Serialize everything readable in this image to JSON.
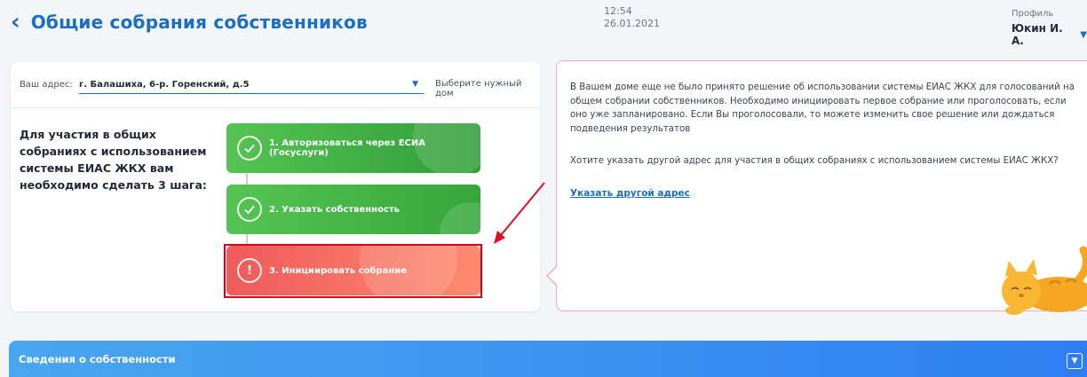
{
  "header": {
    "title": "Общие собрания собственников",
    "time": "12:54",
    "date": "26.01.2021",
    "profile_label": "Профиль",
    "profile_name": "Юкин И. А."
  },
  "address": {
    "label": "Ваш адрес:",
    "value": "г. Балашиха, 6-р. Горенский, д.5",
    "hint": "Выберите нужный дом"
  },
  "steps": {
    "intro": "Для участия в общих собраниях с использованием системы ЕИАС ЖКХ вам необходимо сделать 3 шага:",
    "items": [
      {
        "label": "1. Авторизоваться через ЕСИА (Госуслуги)",
        "status": "done",
        "icon": "check-icon"
      },
      {
        "label": "2. Указать собственность",
        "status": "done",
        "icon": "check-icon"
      },
      {
        "label": "3. Инициировать собрание",
        "status": "pending",
        "icon": "exclamation-icon"
      }
    ]
  },
  "info": {
    "paragraph1": "В Вашем доме еще не было принято решение об использовании системы ЕИАС ЖКХ для голосований на общем собрании собственников. Необходимо инициировать первое собрание или проголосовать, если оно уже запланировано. Если Вы проголосовали, то можете изменить свое решение или дождаться подведения результатов",
    "paragraph2": "Хотите указать другой адрес для участия в общих собраниях с использованием системы ЕИАС ЖКХ?",
    "link": "Указать другой адрес"
  },
  "property_section": {
    "label": "Сведения о собственности"
  },
  "colors": {
    "accent": "#1a6fc4",
    "success": "#3aaa40",
    "danger": "#ef5b5b",
    "highlight": "#d2001a"
  }
}
